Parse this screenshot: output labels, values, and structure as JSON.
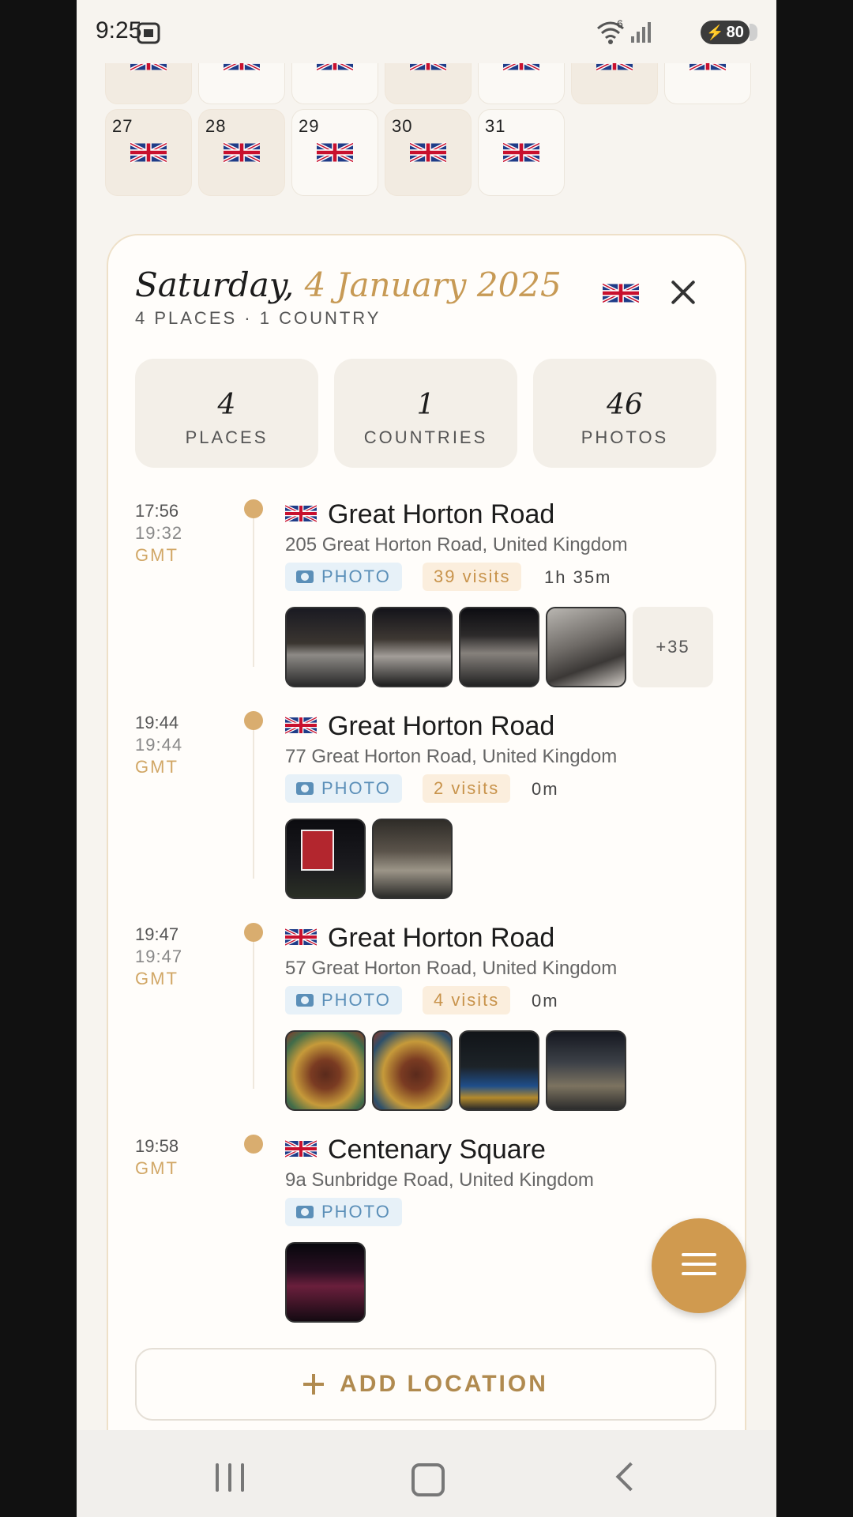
{
  "status_bar": {
    "time": "9:25",
    "battery": "80",
    "wifi_badge": "6"
  },
  "calendar": {
    "partial_row": [
      {
        "tinted": true
      },
      {
        "tinted": false
      },
      {
        "tinted": false
      },
      {
        "tinted": true
      },
      {
        "tinted": false
      },
      {
        "tinted": true
      },
      {
        "tinted": false
      }
    ],
    "days": [
      {
        "day": "27",
        "tinted": true
      },
      {
        "day": "28",
        "tinted": true
      },
      {
        "day": "29",
        "tinted": false
      },
      {
        "day": "30",
        "tinted": true
      },
      {
        "day": "31",
        "tinted": false
      }
    ]
  },
  "day_card": {
    "weekday": "Saturday,",
    "date": "4 January 2025",
    "subtitle": "4 PLACES · 1 COUNTRY",
    "stats": [
      {
        "value": "4",
        "label": "PLACES"
      },
      {
        "value": "1",
        "label": "COUNTRIES"
      },
      {
        "value": "46",
        "label": "PHOTOS"
      }
    ],
    "entries": [
      {
        "time_start": "17:56",
        "time_end": "19:32",
        "tz": "GMT",
        "name": "Great Horton Road",
        "address": "205 Great Horton Road, United Kingdom",
        "chip": "PHOTO",
        "visits": "39 visits",
        "duration": "1h 35m",
        "thumbs": [
          "storefront-night-photo",
          "storefront-night-photo",
          "storefront-night-photo",
          "restaurant-interior-photo"
        ],
        "more": "+35"
      },
      {
        "time_start": "19:44",
        "time_end": "19:44",
        "tz": "GMT",
        "name": "Great Horton Road",
        "address": "77 Great Horton Road, United Kingdom",
        "chip": "PHOTO",
        "visits": "2 visits",
        "duration": "0m",
        "thumbs": [
          "for-sale-sign-photo",
          "house-night-photo"
        ]
      },
      {
        "time_start": "19:47",
        "time_end": "19:47",
        "tz": "GMT",
        "name": "Great Horton Road",
        "address": "57 Great Horton Road, United Kingdom",
        "chip": "PHOTO",
        "visits": "4 visits",
        "duration": "0m",
        "thumbs": [
          "mural-photo",
          "mural-photo",
          "street-night-photo",
          "building-night-photo"
        ]
      },
      {
        "time_start": "19:58",
        "tz": "GMT",
        "name": "Centenary Square",
        "address": "9a Sunbridge Road, United Kingdom",
        "chip": "PHOTO",
        "thumbs": [
          "tower-night-photo"
        ]
      }
    ],
    "add_label": "ADD LOCATION"
  },
  "colors": {
    "accent": "#d09a4f",
    "gold_text": "#c79a55",
    "photo_chip": "#5b8fb8",
    "background": "#f7f4ef"
  }
}
